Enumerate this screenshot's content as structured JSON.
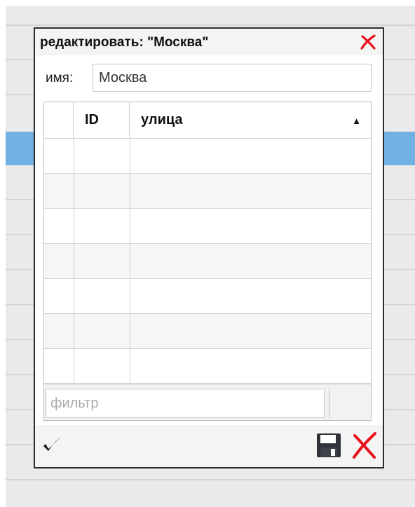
{
  "dialog": {
    "title": "редактировать: \"Москва\"",
    "name_label": "имя:",
    "name_value": "Москва"
  },
  "grid": {
    "columns": [
      "",
      "ID",
      "улица"
    ],
    "sort": {
      "column": "улица",
      "direction": "ascending"
    },
    "sort_arrow": "▲",
    "row_count": 7,
    "filter_placeholder": "фильтр",
    "filter_value": ""
  },
  "icons": {
    "close": "close-icon",
    "ok": "checkmark-icon",
    "save": "floppy-disk-icon",
    "cancel": "cancel-icon"
  },
  "colors": {
    "selection": "#72b2e3",
    "close_red": "#e8101b",
    "dialog_border": "#2c2c2c"
  }
}
